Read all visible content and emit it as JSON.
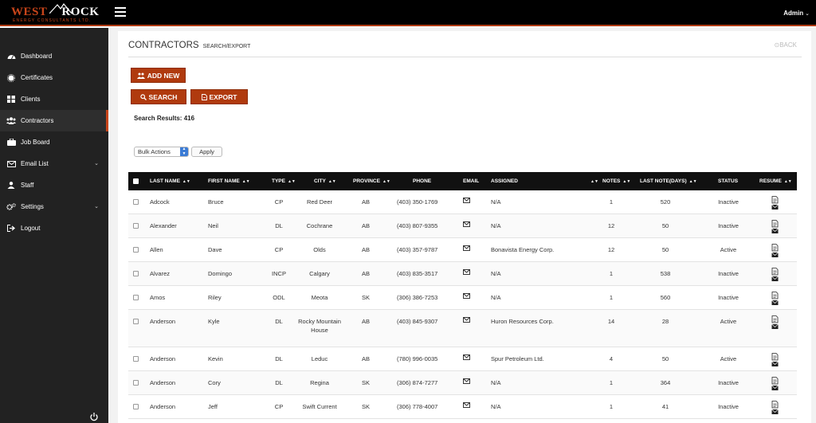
{
  "app": {
    "logo_main_left": "WEST",
    "logo_main_right": "ROCK",
    "logo_sub": "ENERGY CONSULTANTS LTD.",
    "user_label": "Admin",
    "colors": {
      "accent": "#b03a0e",
      "topbar": "#000000",
      "sidebar": "#222222"
    }
  },
  "sidebar": {
    "items": [
      {
        "label": "Dashboard",
        "icon": "dashboard-icon",
        "active": false
      },
      {
        "label": "Certificates",
        "icon": "certificate-icon",
        "active": false
      },
      {
        "label": "Clients",
        "icon": "grid-icon",
        "active": false
      },
      {
        "label": "Contractors",
        "icon": "users-icon",
        "active": true
      },
      {
        "label": "Job Board",
        "icon": "briefcase-icon",
        "active": false
      },
      {
        "label": "Email List",
        "icon": "envelope-icon",
        "active": false,
        "chevron": true
      },
      {
        "label": "Staff",
        "icon": "user-icon",
        "active": false
      },
      {
        "label": "Settings",
        "icon": "cogs-icon",
        "active": false,
        "chevron": true
      },
      {
        "label": "Logout",
        "icon": "sign-out-icon",
        "active": false
      }
    ]
  },
  "page": {
    "title": "CONTRACTORS",
    "subtitle": "SEARCH/EXPORT",
    "back_label": "BACK",
    "add_new_label": "ADD NEW",
    "search_label": "SEARCH",
    "export_label": "EXPORT",
    "results_text": "Search Results: 416",
    "bulk_actions_selected": "Bulk Actions",
    "apply_label": "Apply"
  },
  "table": {
    "headers": {
      "last_name": "LAST NAME",
      "first_name": "FIRST NAME",
      "type": "TYPE",
      "city": "CITY",
      "province": "PROVINCE",
      "phone": "PHONE",
      "email": "EMAIL",
      "assigned": "ASSIGNED",
      "notes": "NOTES",
      "last_note": "LAST NOTE(DAYS)",
      "status": "STATUS",
      "resume": "RESUME"
    },
    "rows": [
      {
        "last": "Adcock",
        "first": "Bruce",
        "type": "CP",
        "city": "Red Deer",
        "province": "AB",
        "phone": "(403) 350-1769",
        "assigned": "N/A",
        "notes": "1",
        "last_note": "520",
        "status": "Inactive"
      },
      {
        "last": "Alexander",
        "first": "Neil",
        "type": "DL",
        "city": "Cochrane",
        "province": "AB",
        "phone": "(403) 807-9355",
        "assigned": "N/A",
        "notes": "12",
        "last_note": "50",
        "status": "Inactive"
      },
      {
        "last": "Allen",
        "first": "Dave",
        "type": "CP",
        "city": "Olds",
        "province": "AB",
        "phone": "(403) 357-9787",
        "assigned": "Bonavista Energy Corp.",
        "notes": "12",
        "last_note": "50",
        "status": "Active"
      },
      {
        "last": "Alvarez",
        "first": "Domingo",
        "type": "INCP",
        "city": "Calgary",
        "province": "AB",
        "phone": "(403) 835-3517",
        "assigned": "N/A",
        "notes": "1",
        "last_note": "538",
        "status": "Inactive"
      },
      {
        "last": "Amos",
        "first": "Riley",
        "type": "ODL",
        "city": "Meota",
        "province": "SK",
        "phone": "(306) 386-7253",
        "assigned": "N/A",
        "notes": "1",
        "last_note": "560",
        "status": "Inactive"
      },
      {
        "last": "Anderson",
        "first": "Kyle",
        "type": "DL",
        "city": "Rocky Mountain House",
        "province": "AB",
        "phone": "(403) 845-9307",
        "assigned": "Huron Resources Corp.",
        "notes": "14",
        "last_note": "28",
        "status": "Active"
      },
      {
        "last": "Anderson",
        "first": "Kevin",
        "type": "DL",
        "city": "Leduc",
        "province": "AB",
        "phone": "(780) 996-0035",
        "assigned": "Spur Petroleum Ltd.",
        "notes": "4",
        "last_note": "50",
        "status": "Active"
      },
      {
        "last": "Anderson",
        "first": "Cory",
        "type": "DL",
        "city": "Regina",
        "province": "SK",
        "phone": "(306) 874-7277",
        "assigned": "N/A",
        "notes": "1",
        "last_note": "364",
        "status": "Inactive"
      },
      {
        "last": "Anderson",
        "first": "Jeff",
        "type": "CP",
        "city": "Swift Current",
        "province": "SK",
        "phone": "(306) 778-4007",
        "assigned": "N/A",
        "notes": "1",
        "last_note": "41",
        "status": "Inactive"
      }
    ]
  }
}
